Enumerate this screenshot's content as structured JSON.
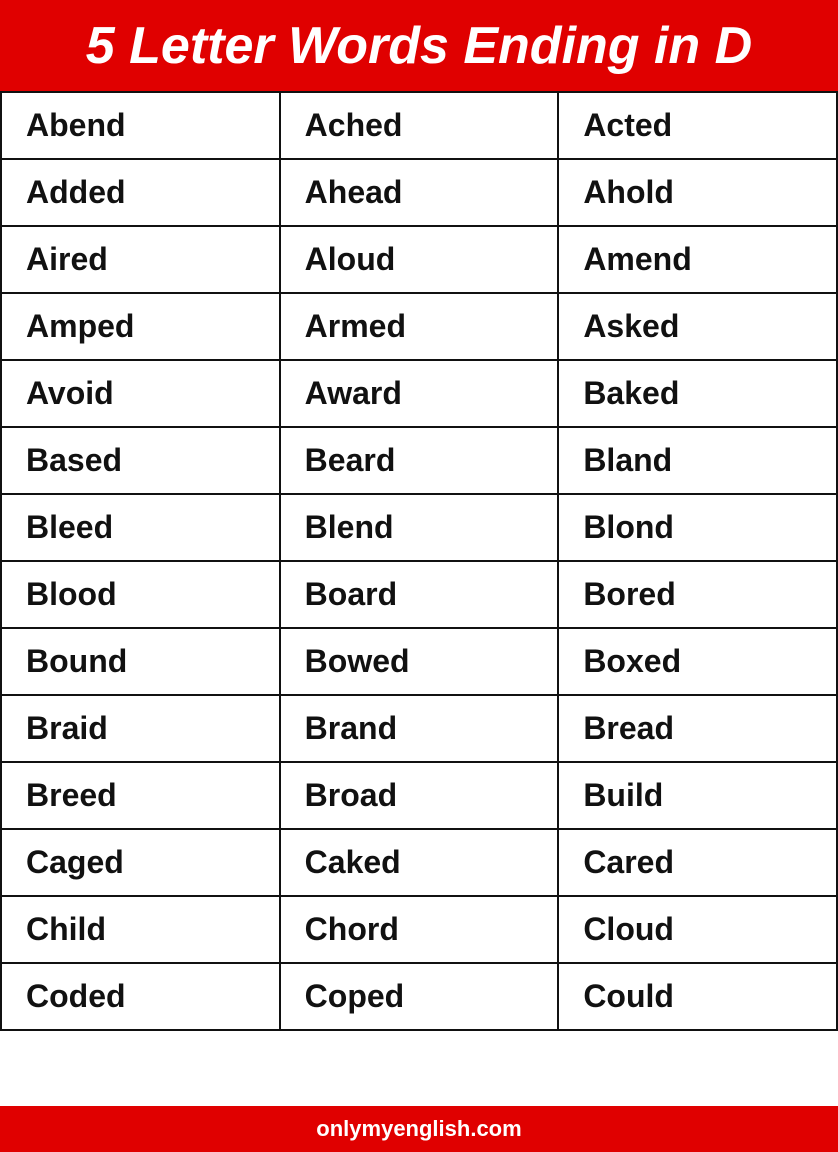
{
  "header": {
    "title": "5 Letter Words Ending in D"
  },
  "rows": [
    [
      "Abend",
      "Ached",
      "Acted"
    ],
    [
      "Added",
      "Ahead",
      "Ahold"
    ],
    [
      "Aired",
      "Aloud",
      "Amend"
    ],
    [
      "Amped",
      "Armed",
      "Asked"
    ],
    [
      "Avoid",
      "Award",
      "Baked"
    ],
    [
      "Based",
      "Beard",
      "Bland"
    ],
    [
      "Bleed",
      "Blend",
      "Blond"
    ],
    [
      "Blood",
      "Board",
      "Bored"
    ],
    [
      "Bound",
      "Bowed",
      "Boxed"
    ],
    [
      "Braid",
      "Brand",
      "Bread"
    ],
    [
      "Breed",
      "Broad",
      "Build"
    ],
    [
      "Caged",
      "Caked",
      "Cared"
    ],
    [
      "Child",
      "Chord",
      "Cloud"
    ],
    [
      "Coded",
      "Coped",
      "Could"
    ]
  ],
  "footer": {
    "url": "onlymyenglish.com"
  }
}
